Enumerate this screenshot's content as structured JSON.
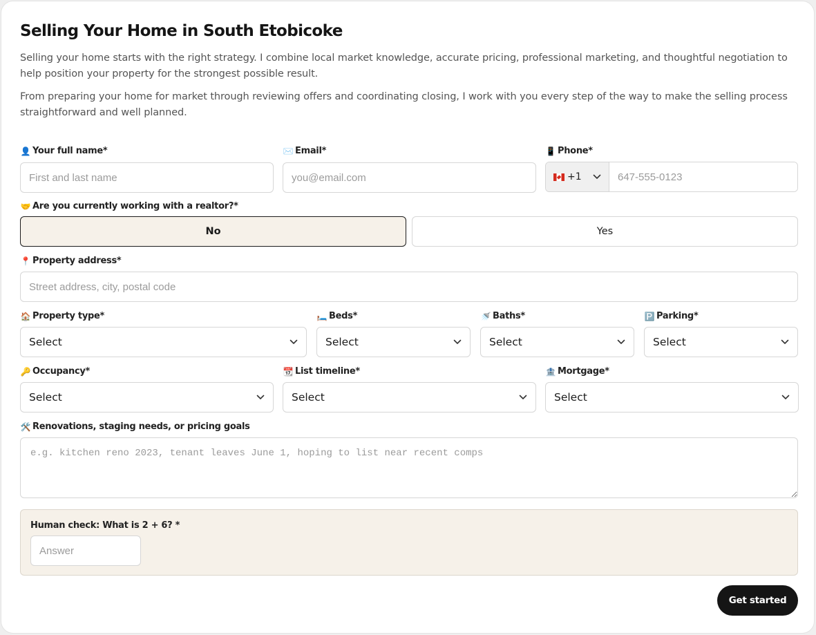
{
  "title": "Selling Your Home in South Etobicoke",
  "intro": [
    "Selling your home starts with the right strategy. I combine local market knowledge, accurate pricing, professional marketing, and thoughtful negotiation to help position your property for the strongest possible result.",
    "From preparing your home for market through reviewing offers and coordinating closing, I work with you every step of the way to make the selling process straightforward and well planned."
  ],
  "fields": {
    "full_name": {
      "icon": "👤",
      "label": "Your full name",
      "required": "*",
      "placeholder": "First and last name"
    },
    "email": {
      "icon": "✉️",
      "label": "Email",
      "required": "*",
      "placeholder": "you@email.com"
    },
    "phone": {
      "icon": "📱",
      "label": "Phone",
      "required": "*",
      "country_code": "+1",
      "placeholder": "647-555-0123"
    },
    "realtor": {
      "icon": "🤝",
      "label": "Are you currently working with a realtor?",
      "required": "*",
      "options": [
        "No",
        "Yes"
      ],
      "selected": "No"
    },
    "address": {
      "icon": "📍",
      "label": "Property address",
      "required": "*",
      "placeholder": "Street address, city, postal code"
    },
    "property_type": {
      "icon": "🏠",
      "label": "Property type",
      "required": "*",
      "value": "Select"
    },
    "beds": {
      "icon": "🛏️",
      "label": "Beds",
      "required": "*",
      "value": "Select"
    },
    "baths": {
      "icon": "🚿",
      "label": "Baths",
      "required": "*",
      "value": "Select"
    },
    "parking": {
      "icon": "🅿️",
      "label": "Parking",
      "required": "*",
      "value": "Select"
    },
    "occupancy": {
      "icon": "🔑",
      "label": "Occupancy",
      "required": "*",
      "value": "Select"
    },
    "list_timeline": {
      "icon": "📆",
      "label": "List timeline",
      "required": "*",
      "value": "Select"
    },
    "mortgage": {
      "icon": "🏦",
      "label": "Mortgage",
      "required": "*",
      "value": "Select"
    },
    "notes": {
      "icon": "🛠️",
      "label": "Renovations, staging needs, or pricing goals",
      "placeholder": "e.g. kitchen reno 2023, tenant leaves June 1, hoping to list near recent comps"
    }
  },
  "human_check": {
    "label": "Human check: What is 2 + 6?",
    "required": "*",
    "placeholder": "Answer"
  },
  "submit_label": "Get started",
  "colors": {
    "accent_bg": "#f6f1e9",
    "button": "#151515",
    "border": "#d6d6d6"
  }
}
